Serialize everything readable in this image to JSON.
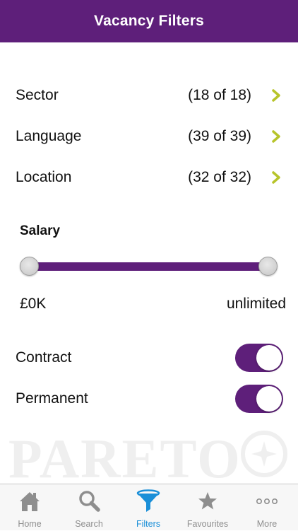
{
  "header": {
    "title": "Vacancy Filters"
  },
  "filters": [
    {
      "label": "Sector",
      "count": "(18 of 18)",
      "icon": "chevron-right-icon"
    },
    {
      "label": "Language",
      "count": "(39 of 39)",
      "icon": "chevron-right-icon"
    },
    {
      "label": "Location",
      "count": "(32 of 32)",
      "icon": "chevron-right-icon"
    }
  ],
  "salary": {
    "title": "Salary",
    "min_label": "£0K",
    "max_label": "unlimited",
    "range_fraction": [
      0,
      1
    ]
  },
  "toggles": [
    {
      "label": "Contract",
      "on": true
    },
    {
      "label": "Permanent",
      "on": true
    }
  ],
  "watermark": {
    "text": "PARETO"
  },
  "tabs": [
    {
      "label": "Home",
      "icon": "home-icon",
      "active": false
    },
    {
      "label": "Search",
      "icon": "search-icon",
      "active": false
    },
    {
      "label": "Filters",
      "icon": "filter-icon",
      "active": true
    },
    {
      "label": "Favourites",
      "icon": "star-icon",
      "active": false
    },
    {
      "label": "More",
      "icon": "more-icon",
      "active": false
    }
  ],
  "colors": {
    "brand_purple": "#5e1f7a",
    "chevron": "#b7c42a",
    "tab_active": "#1a8fd8",
    "tab_inactive": "#8e8e8e"
  }
}
